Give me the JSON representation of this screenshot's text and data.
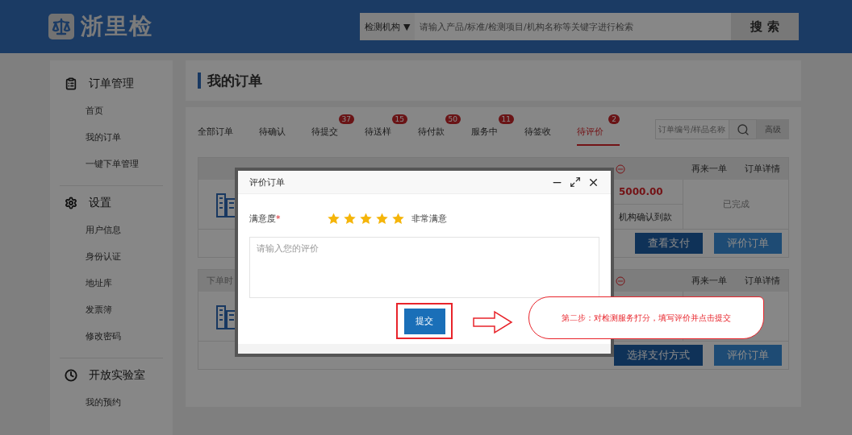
{
  "header": {
    "logo": "浙里检",
    "search": {
      "category": "检测机构",
      "caret": "▼",
      "placeholder": "请输入产品/标准/检测项目/机构名称等关键字进行检索",
      "button": "搜 索"
    }
  },
  "sidebar": [
    {
      "kind": "orders",
      "title": "订单管理",
      "items": [
        "首页",
        "我的订单",
        "一键下单管理"
      ]
    },
    {
      "kind": "settings",
      "title": "设置",
      "items": [
        "用户信息",
        "身份认证",
        "地址库",
        "发票簿",
        "修改密码"
      ]
    },
    {
      "kind": "lab",
      "title": "开放实验室",
      "items": [
        "我的预约"
      ]
    }
  ],
  "page_title": "我的订单",
  "tabs": [
    {
      "label": "全部订单",
      "selected": false
    },
    {
      "label": "待确认",
      "selected": false
    },
    {
      "label": "待提交",
      "badge": "37",
      "selected": false
    },
    {
      "label": "待送样",
      "badge": "15",
      "selected": false
    },
    {
      "label": "待付款",
      "badge": "50",
      "selected": false
    },
    {
      "label": "服务中",
      "badge": "11",
      "selected": false
    },
    {
      "label": "待签收",
      "selected": false
    },
    {
      "label": "待评价",
      "badge": "2",
      "selected": true
    }
  ],
  "order_search": {
    "placeholder": "订单编号/样品名称",
    "advanced": "高级"
  },
  "orders": [
    {
      "actions": [
        "再来一单",
        "订单详情"
      ],
      "price": "5000.00",
      "payment_note": "机构确认到款",
      "status": "已完成",
      "buttons": [
        {
          "label": "查看支付",
          "kind": "dark"
        },
        {
          "label": "评价订单",
          "kind": "light"
        }
      ]
    },
    {
      "header_left": "下单时",
      "actions": [
        "再来一单",
        "订单详情"
      ],
      "buttons": [
        {
          "label": "选择支付方式",
          "kind": "dark"
        },
        {
          "label": "评价订单",
          "kind": "light"
        }
      ]
    }
  ],
  "modal": {
    "title": "评价订单",
    "rating_label": "满意度",
    "required_mark": "*",
    "stars": 5,
    "rating_text": "非常满意",
    "comment_placeholder": "请输入您的评价",
    "submit": "提交"
  },
  "annotation": {
    "text": "第二步：对检测服务打分，填写评价并点击提交"
  }
}
